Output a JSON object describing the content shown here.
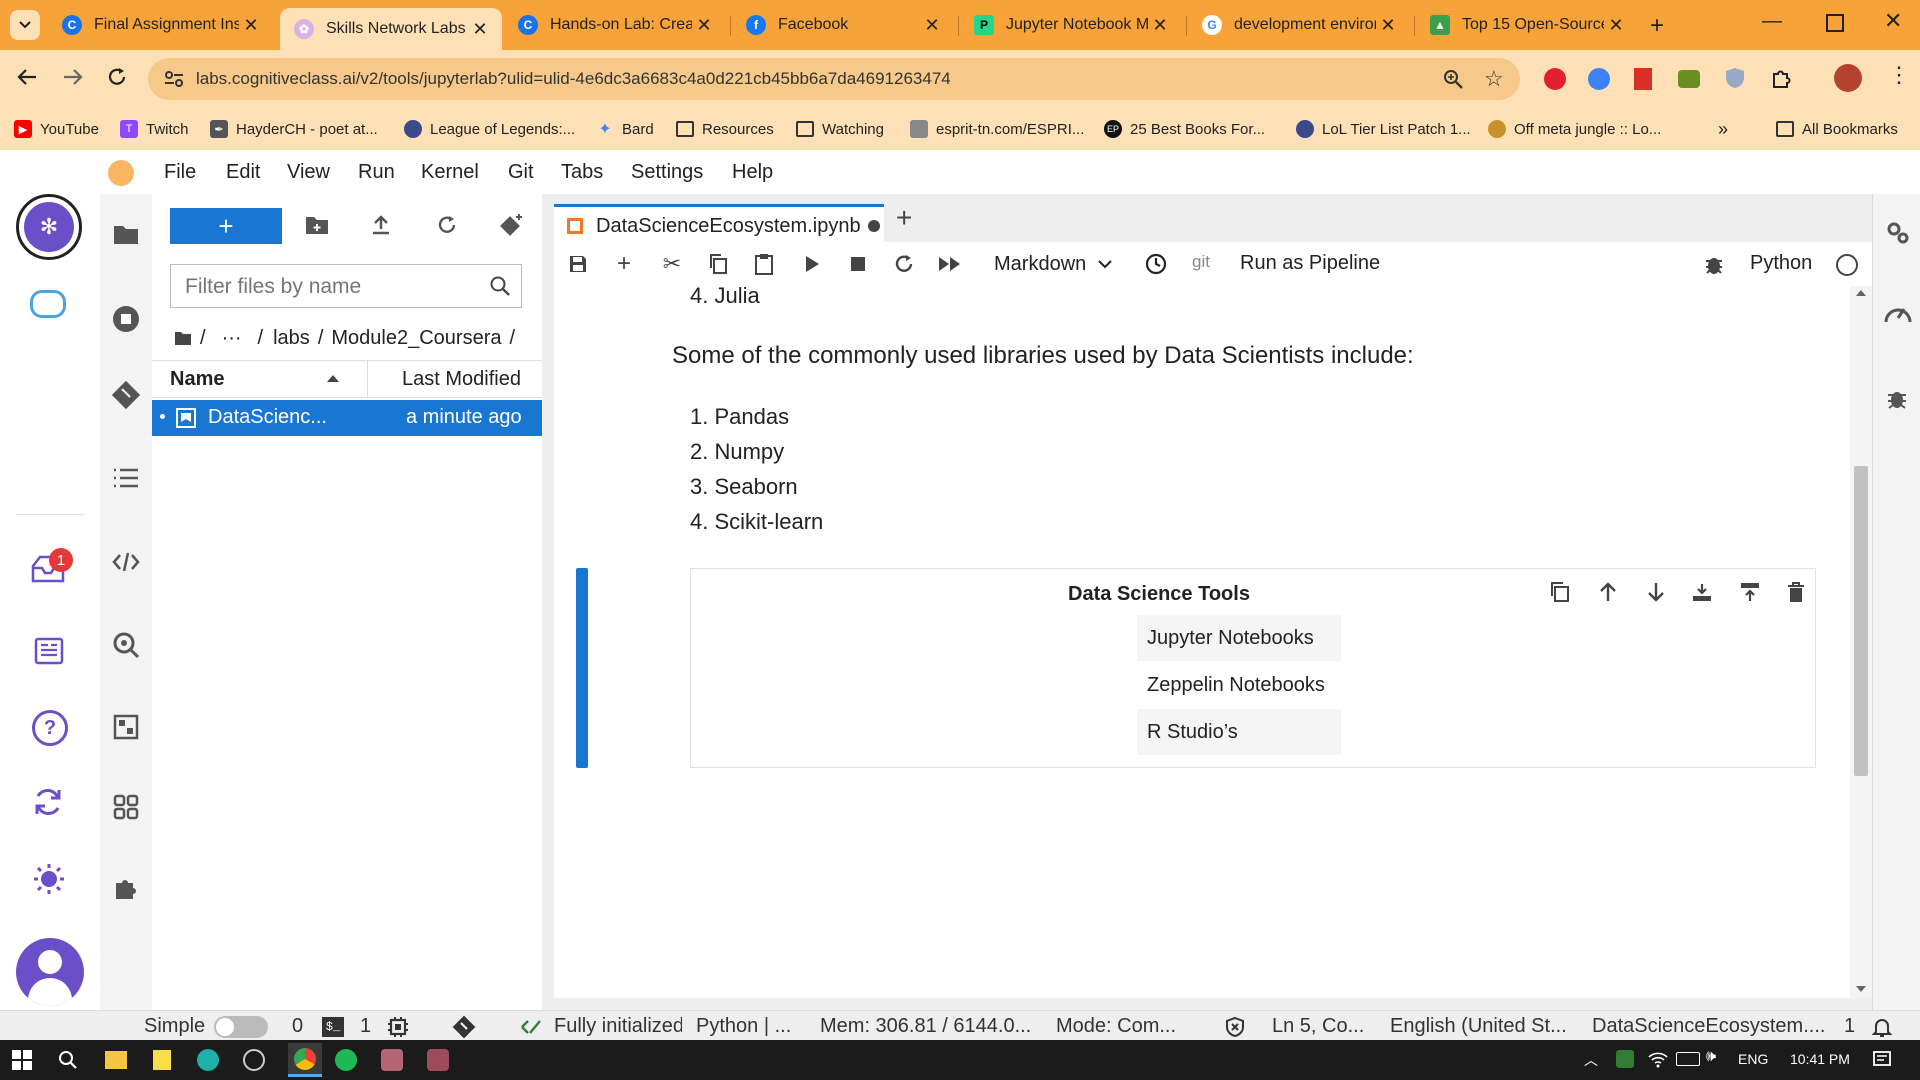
{
  "browser": {
    "tabs": [
      {
        "title": "Final Assignment Inst",
        "icon": "coursera-icon"
      },
      {
        "title": "Skills Network Labs",
        "icon": "skills-network-icon"
      },
      {
        "title": "Hands-on Lab: Create",
        "icon": "coursera-icon"
      },
      {
        "title": "Facebook",
        "icon": "facebook-icon"
      },
      {
        "title": "Jupyter Notebook M",
        "icon": "pycharm-icon"
      },
      {
        "title": "development enviror",
        "icon": "google-icon"
      },
      {
        "title": "Top 15 Open-Source",
        "icon": "site-icon"
      }
    ],
    "url": "labs.cognitiveclass.ai/v2/tools/jupyterlab?ulid=ulid-4e6dc3a6683c4a0d221cb45bb6a7da4691263474",
    "bookmarks": [
      {
        "label": "YouTube",
        "icon": "youtube-icon"
      },
      {
        "label": "Twitch",
        "icon": "twitch-icon"
      },
      {
        "label": "HayderCH - poet at...",
        "icon": "site-icon"
      },
      {
        "label": "League of Legends:...",
        "icon": "site-icon"
      },
      {
        "label": "Bard",
        "icon": "bard-icon"
      },
      {
        "label": "Resources",
        "icon": "folder-icon"
      },
      {
        "label": "Watching",
        "icon": "folder-icon"
      },
      {
        "label": "esprit-tn.com/ESPRI...",
        "icon": "site-icon"
      },
      {
        "label": "25 Best Books For...",
        "icon": "ep-icon"
      },
      {
        "label": "LoL Tier List Patch 1...",
        "icon": "site-icon"
      },
      {
        "label": "Off meta jungle :: Lo...",
        "icon": "site-icon"
      }
    ],
    "all_bookmarks": "All Bookmarks",
    "overflow": "»"
  },
  "menu": [
    "File",
    "Edit",
    "View",
    "Run",
    "Kernel",
    "Git",
    "Tabs",
    "Settings",
    "Help"
  ],
  "filebrowser": {
    "filter_placeholder": "Filter files by name",
    "breadcrumb": {
      "sep1": "/",
      "ellipsis": "···",
      "dir1": "labs",
      "sep2": "/",
      "dir2": "Module2_Coursera",
      "sep3": "/"
    },
    "col_name": "Name",
    "col_modified": "Last Modified",
    "files": [
      {
        "name": "DataScienc...",
        "modified": "a minute ago"
      }
    ],
    "new_button": "+"
  },
  "notebook": {
    "tab_title": "DataScienceEcosystem.ipynb",
    "cell_type": "Markdown",
    "git_label": "git",
    "run_pipeline": "Run as Pipeline",
    "kernel": "Python",
    "lang_item": "4.",
    "lang_text": "Julia",
    "libraries_heading": "Some of the commonly used libraries used by Data Scientists include:",
    "libraries": [
      {
        "num": "1.",
        "name": "Pandas"
      },
      {
        "num": "2.",
        "name": "Numpy"
      },
      {
        "num": "3.",
        "name": "Seaborn"
      },
      {
        "num": "4.",
        "name": "Scikit-learn"
      }
    ],
    "table_header": "Data Science Tools",
    "table_rows": [
      "Jupyter Notebooks",
      "Zeppelin Notebooks",
      "R Studio’s"
    ]
  },
  "statusbar": {
    "simple": "Simple",
    "terminals": "0",
    "kernels": "1",
    "git_status": "Fully initialized",
    "kernel_status": "Python | ...",
    "mem": "Mem: 306.81 / 6144.0...",
    "mode": "Mode: Com...",
    "position": "Ln 5, Co...",
    "language": "English (United St...",
    "filename": "DataScienceEcosystem....",
    "count": "1"
  },
  "notifications": "1",
  "taskbar": {
    "lang": "ENG",
    "time": "10:41 PM"
  },
  "colors": {
    "chrome_frame": "#f7a33a",
    "chrome_toolbar": "#fde0b6",
    "jupyter_accent": "#1976d2"
  }
}
